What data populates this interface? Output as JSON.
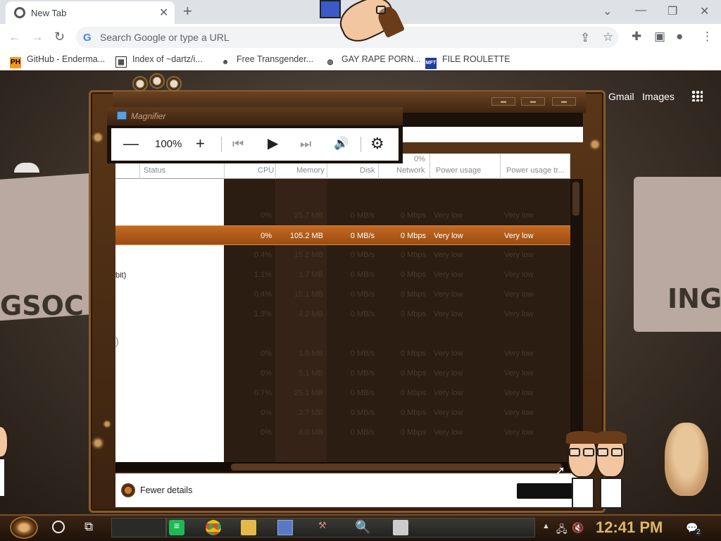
{
  "browser": {
    "tab_title": "New Tab",
    "omnibox_placeholder": "Search Google or type a URL",
    "bookmarks": [
      {
        "label": "GitHub - Enderma...",
        "icon": "PH"
      },
      {
        "label": "Index of ~dartz/i...",
        "icon": "index-icon"
      },
      {
        "label": "Free Transgender...",
        "icon": "mask-icon"
      },
      {
        "label": "GAY RAPE PORN...",
        "icon": "globe-icon"
      },
      {
        "label": "FILE ROULETTE",
        "icon": "MFT"
      }
    ]
  },
  "google": {
    "gmail": "Gmail",
    "images": "Images"
  },
  "desktop_signs": {
    "left": "GSOC",
    "right": "ING"
  },
  "magnifier": {
    "title": "Magnifier",
    "zoom": "100%"
  },
  "task_manager": {
    "columns": {
      "status": "Status",
      "cpu": "CPU",
      "memory": "Memory",
      "disk": "Disk",
      "network": "Network",
      "network_pct": "0%",
      "power": "Power usage",
      "power_trend": "Power usage tr..."
    },
    "rows": [
      {
        "cpu": "0%",
        "memory": "25.7 MB",
        "disk": "0 MB/s",
        "network": "0 Mbps",
        "power": "Very low",
        "trend": "Very low"
      },
      {
        "cpu": "0%",
        "memory": "105.2 MB",
        "disk": "0 MB/s",
        "network": "0 Mbps",
        "power": "Very low",
        "trend": "Very low",
        "selected": true
      },
      {
        "cpu": "0.4%",
        "memory": "15.2 MB",
        "disk": "0 MB/s",
        "network": "0 Mbps",
        "power": "Very low",
        "trend": "Very low"
      },
      {
        "cpu": "1.1%",
        "memory": "1.7 MB",
        "disk": "0 MB/s",
        "network": "0 Mbps",
        "power": "Very low",
        "trend": "Very low"
      },
      {
        "cpu": "0.4%",
        "memory": "15.1 MB",
        "disk": "0 MB/s",
        "network": "0 Mbps",
        "power": "Very low",
        "trend": "Very low"
      },
      {
        "cpu": "1.3%",
        "memory": "4.2 MB",
        "disk": "0 MB/s",
        "network": "0 Mbps",
        "power": "Very low",
        "trend": "Very low"
      },
      {
        "cpu": "0%",
        "memory": "1.9 MB",
        "disk": "0 MB/s",
        "network": "0 Mbps",
        "power": "Very low",
        "trend": "Very low"
      },
      {
        "cpu": "0%",
        "memory": "5.1 MB",
        "disk": "0 MB/s",
        "network": "0 Mbps",
        "power": "Very low",
        "trend": "Very low"
      },
      {
        "cpu": "0.7%",
        "memory": "25.1 MB",
        "disk": "0 MB/s",
        "network": "0 Mbps",
        "power": "Very low",
        "trend": "Very low"
      },
      {
        "cpu": "0%",
        "memory": "2.7 MB",
        "disk": "0 MB/s",
        "network": "0 Mbps",
        "power": "Very low",
        "trend": "Very low"
      },
      {
        "cpu": "0%",
        "memory": "6.0 MB",
        "disk": "0 MB/s",
        "network": "0 Mbps",
        "power": "Very low",
        "trend": "Very low"
      }
    ],
    "left_snippets": [
      "bit)",
      ")"
    ],
    "footer": {
      "fewer_details": "Fewer details"
    }
  },
  "taskbar": {
    "clock": "12:41 PM",
    "notification_count": "2"
  }
}
